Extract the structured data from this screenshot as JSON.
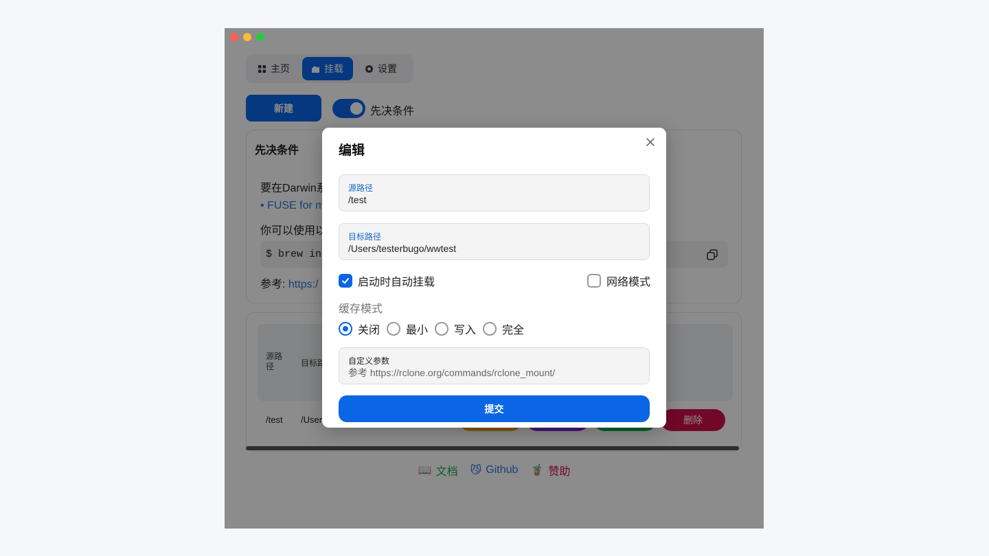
{
  "window": {
    "traffic_colors": [
      "#ff5f57",
      "#febc2e",
      "#28c840"
    ]
  },
  "nav": {
    "items": [
      {
        "label": "主页",
        "icon": "grid-icon",
        "active": false
      },
      {
        "label": "挂载",
        "icon": "mount-icon",
        "active": true
      },
      {
        "label": "设置",
        "icon": "gear-icon",
        "active": false
      }
    ]
  },
  "toolbar": {
    "new_label": "新建",
    "toggle_label": "先决条件",
    "toggle_on": true
  },
  "prereq_card": {
    "title": "先决条件",
    "requirement_text": "要在Darwin系",
    "list_item": "FUSE for m",
    "use_text": "你可以使用以",
    "command": "$ brew ins",
    "ref_label": "参考: ",
    "ref_link": "https:/"
  },
  "mount_table": {
    "headers": {
      "source": "源路径",
      "target": "目标路"
    },
    "rows": [
      {
        "source": "/test",
        "target": "/User"
      }
    ],
    "actions": [
      {
        "label": "",
        "color": "#e8a020"
      },
      {
        "label": "",
        "color": "#7a2bd4"
      },
      {
        "label": "",
        "color": "#18a957"
      },
      {
        "label": "删除",
        "color": "#d0104c"
      }
    ]
  },
  "footer": {
    "links": [
      {
        "emoji": "📖",
        "label": "文档",
        "color": "#18a957"
      },
      {
        "emoji": "😼",
        "label": "Github",
        "color": "#2a78d6"
      },
      {
        "emoji": "🧋",
        "label": "赞助",
        "color": "#d0104c"
      }
    ]
  },
  "modal": {
    "title": "编辑",
    "source_field": {
      "label": "源路径",
      "value": "/test"
    },
    "target_field": {
      "label": "目标路径",
      "value": "/Users/testerbugo/wwtest"
    },
    "auto_mount": {
      "label": "启动时自动挂载",
      "checked": true
    },
    "network_mode": {
      "label": "网络模式",
      "checked": false
    },
    "cache_label": "缓存模式",
    "cache_options": [
      {
        "label": "关闭",
        "checked": true
      },
      {
        "label": "最小",
        "checked": false
      },
      {
        "label": "写入",
        "checked": false
      },
      {
        "label": "完全",
        "checked": false
      }
    ],
    "custom_field": {
      "label": "自定义参数",
      "placeholder": "参考 https://rclone.org/commands/rclone_mount/"
    },
    "submit_label": "提交"
  }
}
